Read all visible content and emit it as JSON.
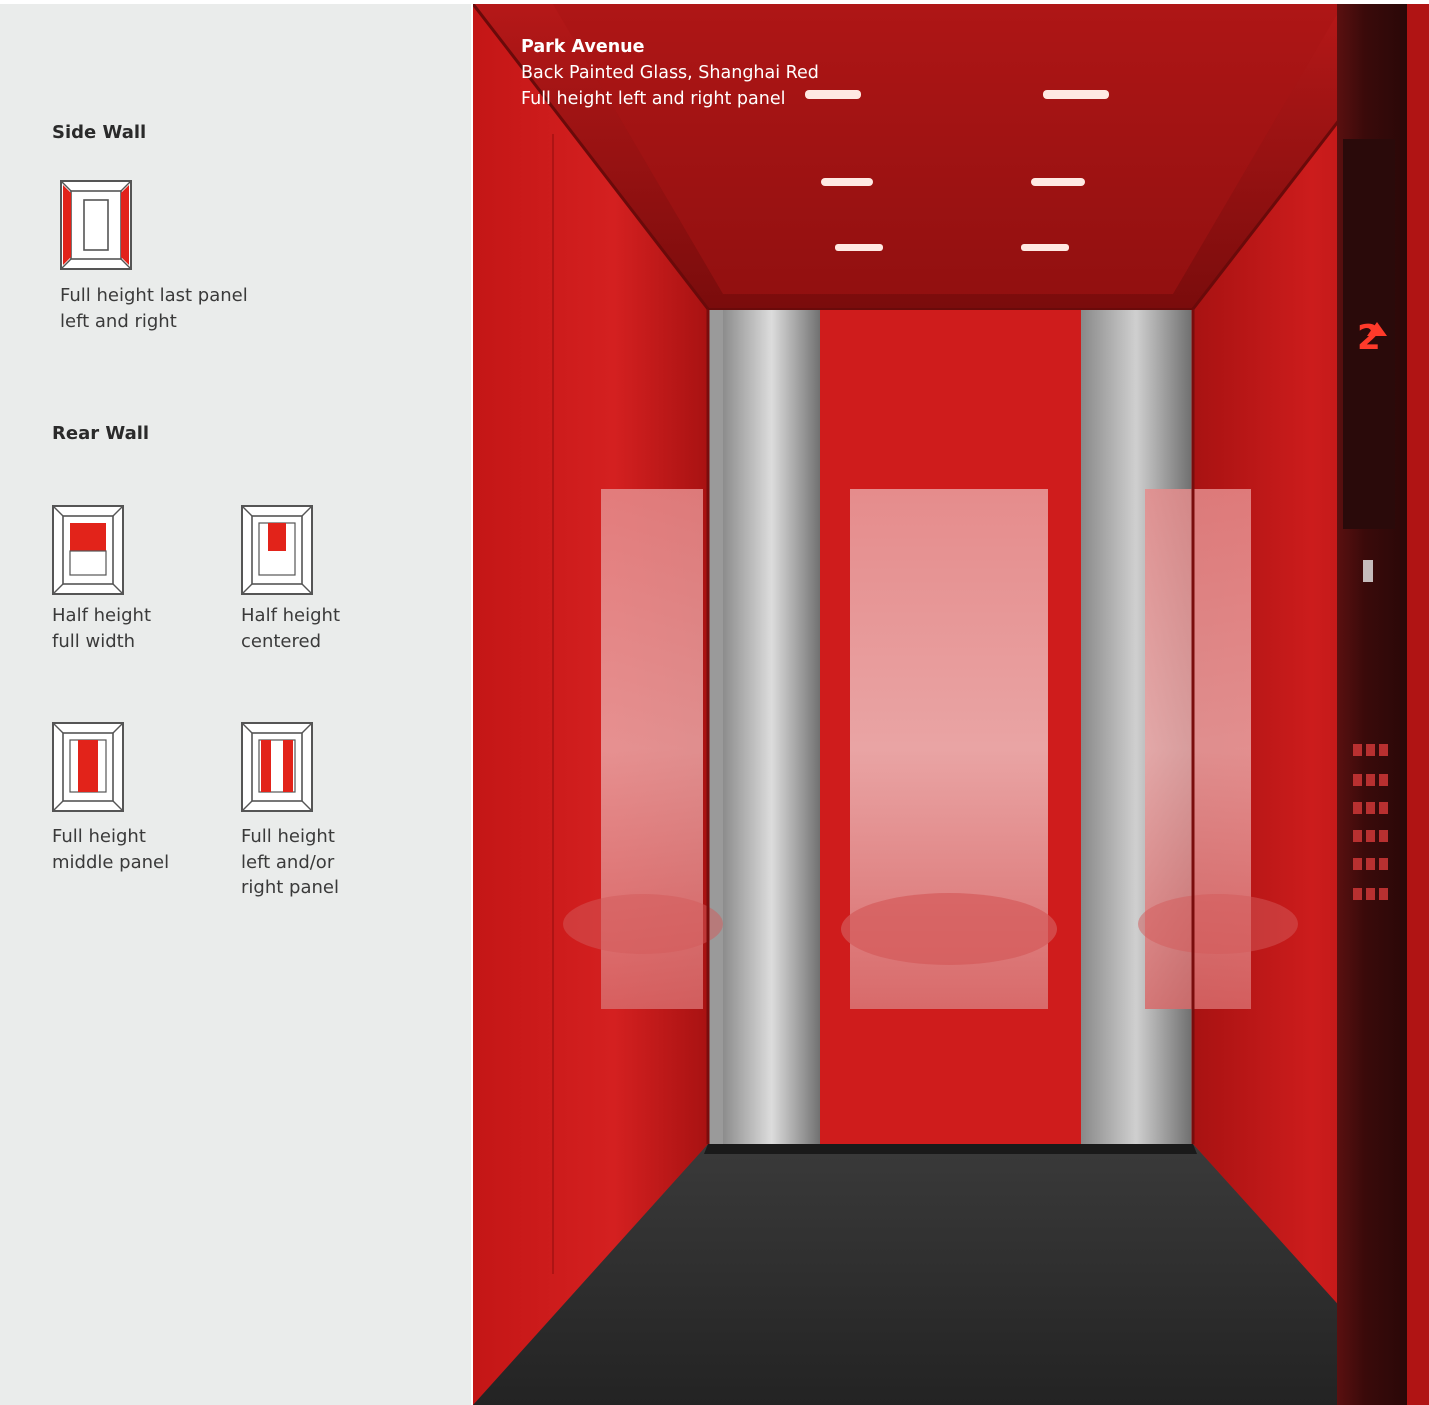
{
  "options": {
    "side_wall": {
      "title": "Side Wall",
      "items": [
        {
          "caption": "Full height last panel\nleft and right",
          "icon": "side-wall-full-height-last-panel-icon"
        }
      ]
    },
    "rear_wall": {
      "title": "Rear Wall",
      "items": [
        {
          "caption": "Half height\nfull width",
          "icon": "rear-wall-half-height-full-width-icon"
        },
        {
          "caption": "Half height\ncentered",
          "icon": "rear-wall-half-height-centered-icon"
        },
        {
          "caption": "Full height\nmiddle panel",
          "icon": "rear-wall-full-height-middle-panel-icon"
        },
        {
          "caption": "Full height\nleft and/or\nright panel",
          "icon": "rear-wall-full-height-left-right-panel-icon"
        }
      ]
    }
  },
  "photo": {
    "title": "Park Avenue",
    "material": "Back Painted Glass, Shanghai Red",
    "configuration": "Full height left and right panel",
    "floor_display": "2"
  },
  "colors": {
    "accent_red": "#e2231a",
    "panel_bg": "#eaeceb",
    "icon_stroke": "#555555"
  }
}
